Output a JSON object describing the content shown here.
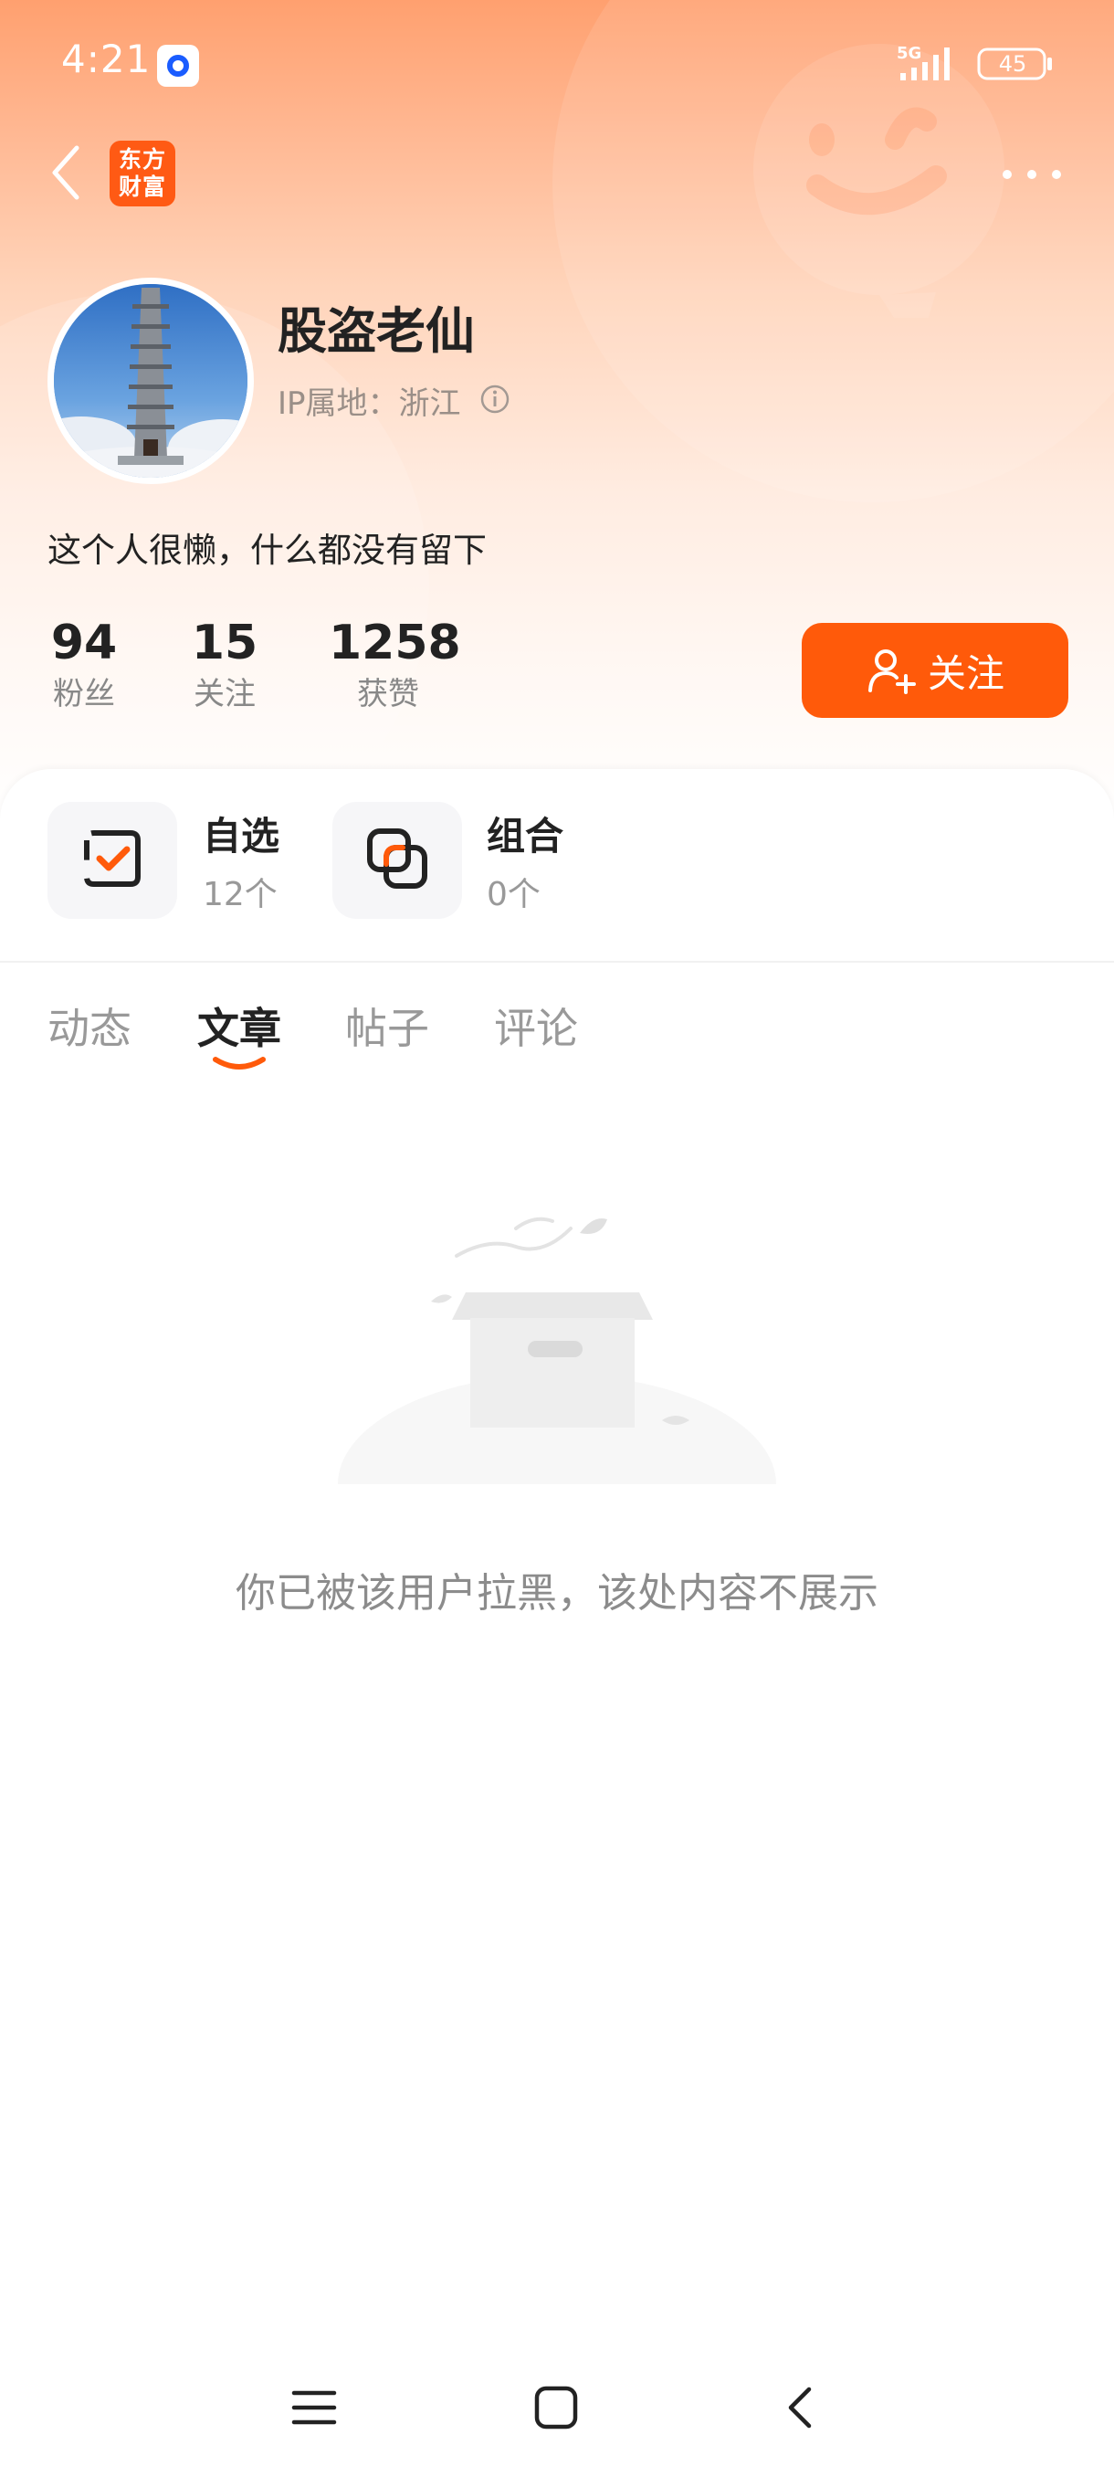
{
  "status_bar": {
    "time": "4:21",
    "network": "5G",
    "battery": "45"
  },
  "nav": {
    "logo_text_line1": "东方",
    "logo_text_line2": "财富"
  },
  "profile": {
    "name": "股盗老仙",
    "ip_location": "IP属地：浙江",
    "bio": "这个人很懒，什么都没有留下"
  },
  "stats": [
    {
      "value": "94",
      "label": "粉丝"
    },
    {
      "value": "15",
      "label": "关注"
    },
    {
      "value": "1258",
      "label": "获赞"
    }
  ],
  "follow_button": {
    "label": "关注"
  },
  "portfolio": {
    "watchlist": {
      "title": "自选",
      "count": "12个"
    },
    "combo": {
      "title": "组合",
      "count": "0个"
    }
  },
  "tabs": [
    {
      "label": "动态"
    },
    {
      "label": "文章"
    },
    {
      "label": "帖子"
    },
    {
      "label": "评论"
    }
  ],
  "active_tab": "文章",
  "empty_state": {
    "message": "你已被该用户拉黑，该处内容不展示"
  },
  "colors": {
    "accent": "#ff5a0a",
    "logo_bg": "#ff5a14",
    "header_top": "#ffa06f"
  },
  "icons": {
    "back": "chevron-left-icon",
    "more": "more-dots-icon",
    "info": "info-circle-icon",
    "follow": "user-plus-icon",
    "watchlist": "checkbox-check-icon",
    "combo": "overlapping-squares-icon",
    "sys_menu": "menu-lines-icon",
    "sys_home": "square-home-icon",
    "sys_back": "chevron-left-icon"
  }
}
